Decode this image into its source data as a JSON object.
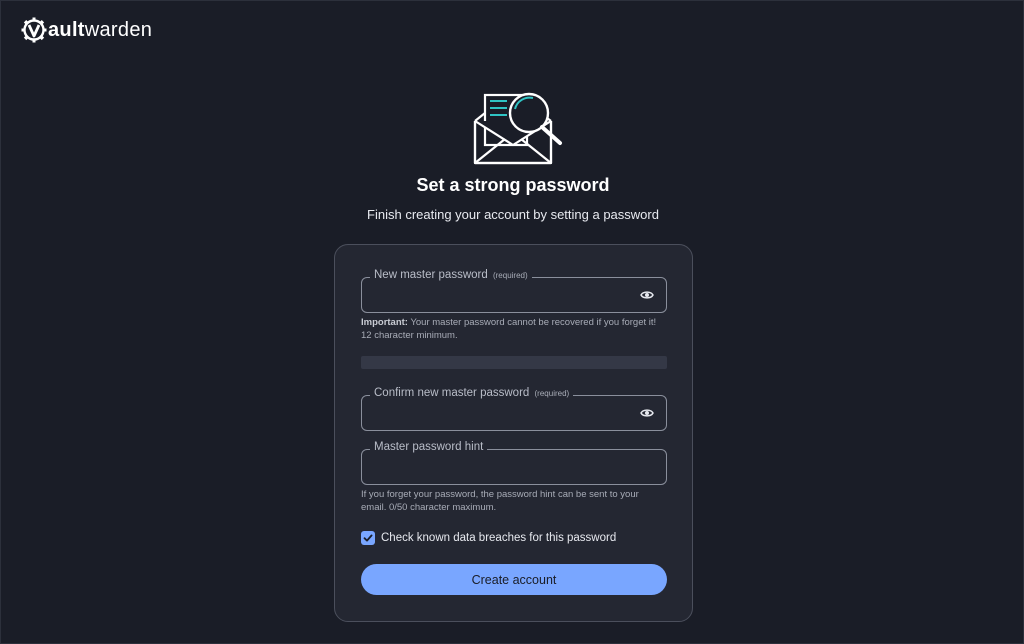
{
  "brand": {
    "logo_initial": "V",
    "name_bold": "ault",
    "name_light": "warden"
  },
  "hero": {
    "title": "Set a strong password",
    "subtitle": "Finish creating your account by setting a password",
    "icon": "envelope-search-icon"
  },
  "form": {
    "new_password": {
      "label": "New master password",
      "required_tag": "(required)",
      "value": "",
      "icon": "eye-icon"
    },
    "new_password_help": {
      "important": "Important:",
      "text": "Your master password cannot be recovered if you forget it!",
      "minimum": "12 character minimum."
    },
    "strength_meter": {
      "value": 0
    },
    "confirm_password": {
      "label": "Confirm new master password",
      "required_tag": "(required)",
      "value": "",
      "icon": "eye-icon"
    },
    "hint": {
      "label": "Master password hint",
      "value": ""
    },
    "hint_help": {
      "line1": "If you forget your password, the password hint can be sent to your",
      "line2": "email. 0/50 character maximum."
    },
    "breach_check": {
      "label": "Check known data breaches for this password",
      "checked": true
    },
    "submit_label": "Create account"
  },
  "colors": {
    "background": "#1a1d27",
    "card": "#242732",
    "accent": "#79a6ff",
    "teal": "#2fc4c4"
  }
}
